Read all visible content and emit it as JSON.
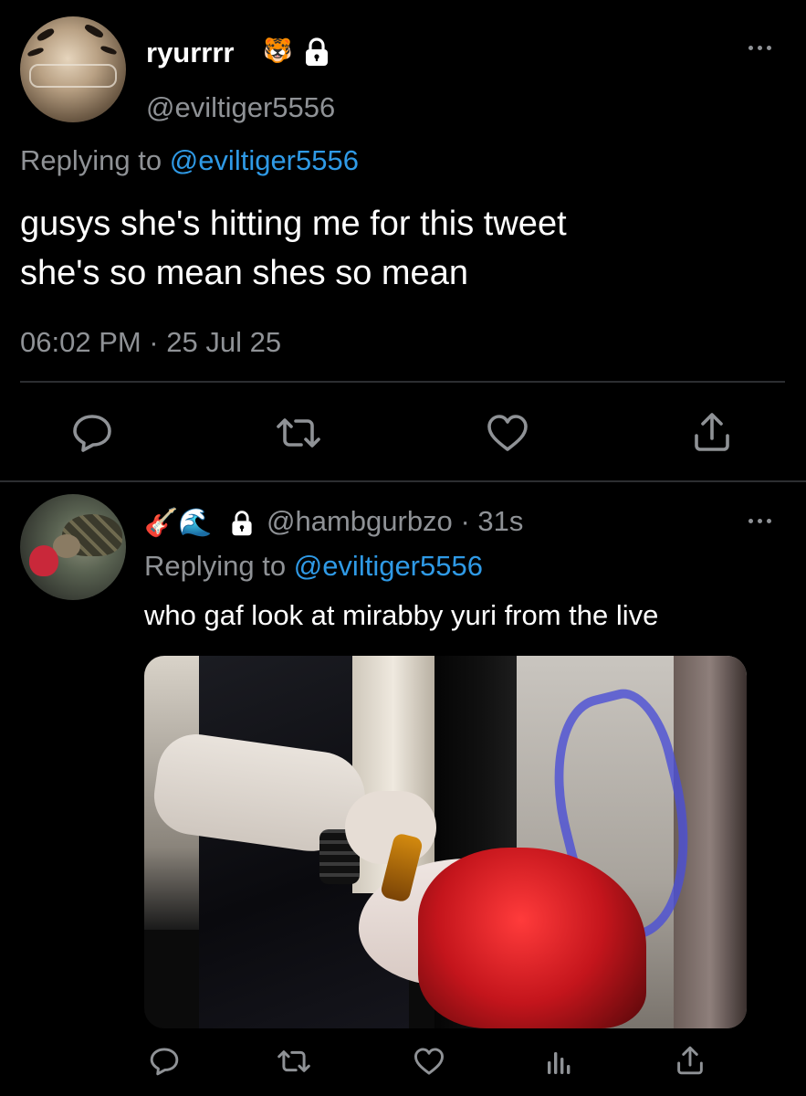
{
  "main_tweet": {
    "display_name": "ryurrrr",
    "name_emoji": "🐯",
    "handle": "@eviltiger5556",
    "replying_prefix": "Replying to",
    "replying_to": "@eviltiger5556",
    "text_line_1": "gusys she's hitting me for this tweet",
    "text_line_2": "she's so mean shes so mean",
    "timestamp": "06:02 PM · 25 Jul 25"
  },
  "reply_tweet": {
    "name_emojis": "🎸🌊",
    "handle": "@hambgurbzo",
    "age": "· 31s",
    "replying_prefix": "Replying to",
    "replying_to": "@eviltiger5556",
    "text": "who gaf look at mirabby yuri from the live"
  },
  "icons": {
    "more": "more-horizontal-icon",
    "lock": "lock-icon",
    "reply": "reply-bubble-icon",
    "retweet": "retweet-icon",
    "like": "heart-icon",
    "share": "share-icon",
    "views": "views-bar-chart-icon"
  },
  "colors": {
    "background": "#000000",
    "text": "#ffffff",
    "muted": "#8f9296",
    "link": "#2f9ae6",
    "divider": "#2c2e31"
  }
}
